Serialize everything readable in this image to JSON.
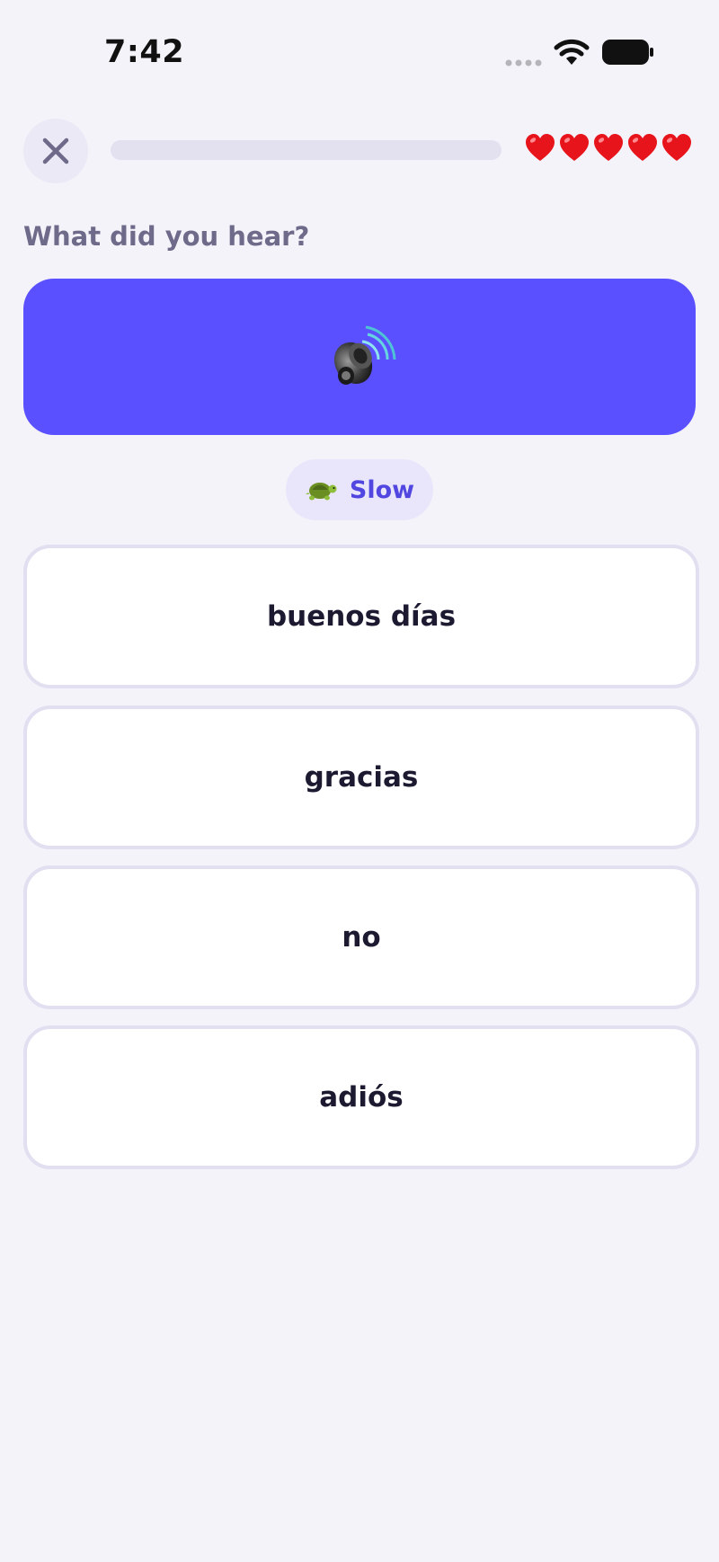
{
  "status_bar": {
    "time": "7:42",
    "signal_icon": "cellular-dots-icon",
    "wifi_icon": "wifi-icon",
    "battery_icon": "battery-icon"
  },
  "header": {
    "close_icon": "close-icon",
    "progress_fraction": 0.0,
    "hearts_count": 5,
    "heart_icon": "heart-icon"
  },
  "exercise": {
    "prompt": "What did you hear?",
    "play_icon": "speaker-icon",
    "slow_label": "Slow",
    "slow_icon": "turtle-icon",
    "options": [
      {
        "label": "buenos días"
      },
      {
        "label": "gracias"
      },
      {
        "label": "no"
      },
      {
        "label": "adiós"
      }
    ]
  },
  "colors": {
    "background": "#f4f3fa",
    "accent": "#5b50ff",
    "prompt_text": "#6d6a8a",
    "option_border": "#e1dff0",
    "heart": "#e8141c"
  }
}
